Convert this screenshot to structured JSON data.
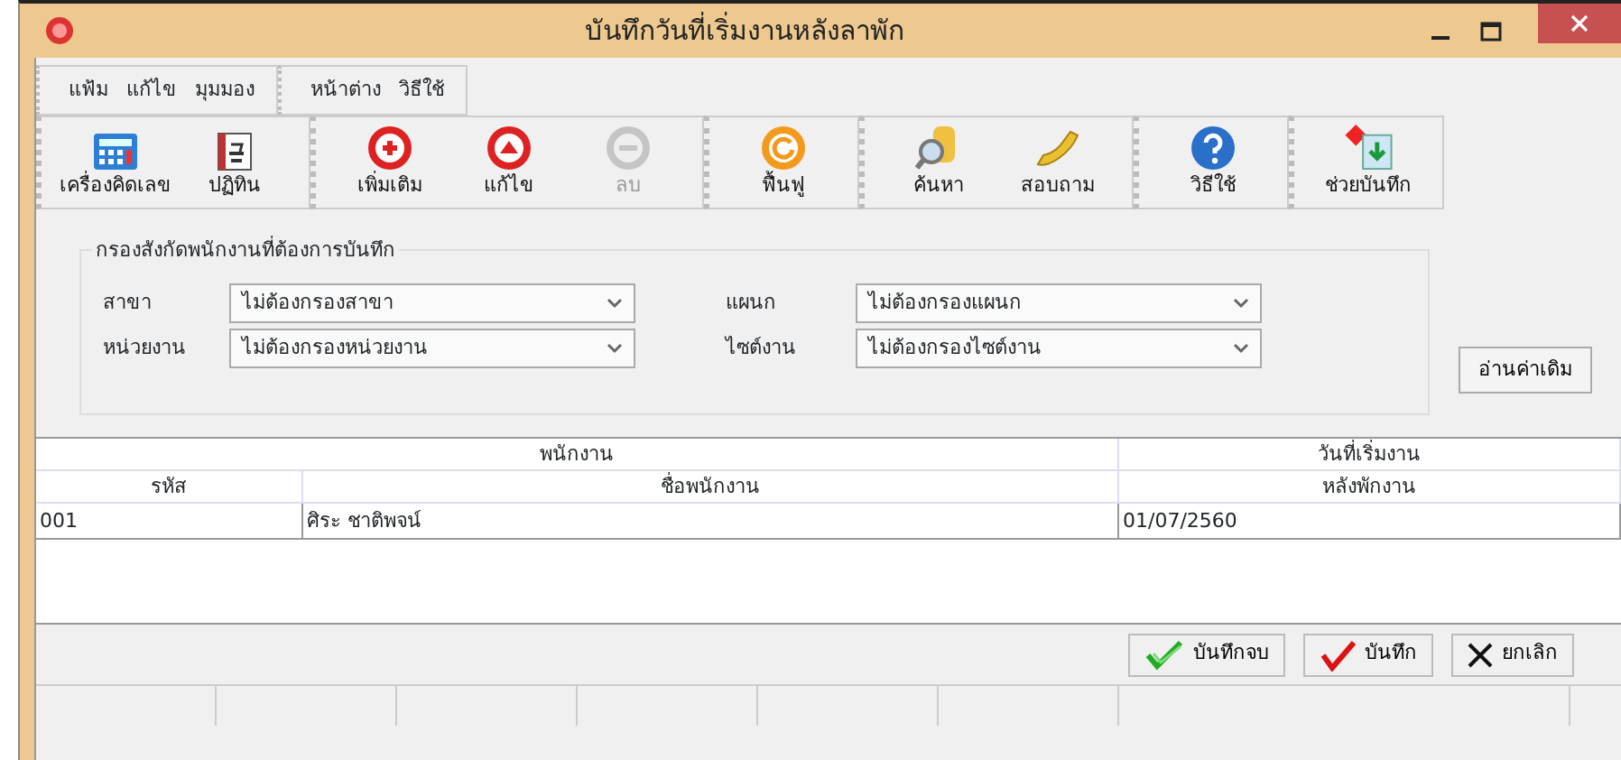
{
  "window": {
    "title": "บันทึกวันที่เริ่มงานหลังลาพัก"
  },
  "menu_groups": [
    {
      "items": [
        "แฟ้ม",
        "แก้ไข",
        "มุมมอง"
      ]
    },
    {
      "items": [
        "หน้าต่าง",
        "วิธีใช้"
      ]
    }
  ],
  "toolbar_groups": [
    {
      "items": [
        {
          "label": "เครื่องคิดเลข",
          "disabled": false
        },
        {
          "label": "ปฏิทิน",
          "disabled": false
        }
      ]
    },
    {
      "items": [
        {
          "label": "เพิ่มเติม",
          "disabled": false
        },
        {
          "label": "แก้ไข",
          "disabled": false
        },
        {
          "label": "ลบ",
          "disabled": true
        }
      ]
    },
    {
      "items": [
        {
          "label": "ฟื้นฟู",
          "disabled": false
        }
      ]
    },
    {
      "items": [
        {
          "label": "ค้นหา",
          "disabled": false
        },
        {
          "label": "สอบถาม",
          "disabled": false
        }
      ]
    },
    {
      "items": [
        {
          "label": "วิธีใช้",
          "disabled": false
        }
      ]
    },
    {
      "items": [
        {
          "label": "ช่วยบันทึก",
          "disabled": false
        }
      ]
    }
  ],
  "filter": {
    "title": "กรองสังกัดพนักงานที่ต้องการบันทึก",
    "fields": [
      {
        "label": "สาขา",
        "value": "ไม่ต้องกรองสาขา"
      },
      {
        "label": "แผนก",
        "value": "ไม่ต้องกรองแผนก"
      },
      {
        "label": "หน่วยงาน",
        "value": "ไม่ต้องกรองหน่วยงาน"
      },
      {
        "label": "ไซต์งาน",
        "value": "ไม่ต้องกรองไซต์งาน"
      }
    ],
    "read_button": "อ่านค่าเดิม"
  },
  "table": {
    "group_headers": [
      "พนักงาน",
      "วันที่เริ่มงาน"
    ],
    "columns": [
      "รหัส",
      "ชื่อพนักงาน",
      "หลังพักงาน"
    ],
    "rows": [
      [
        "001",
        "ศิระ  ชาติพจน์",
        "01/07/2560"
      ]
    ]
  },
  "actions": [
    "บันทึกจบ",
    "บันทึก",
    "ยกเลิก"
  ]
}
